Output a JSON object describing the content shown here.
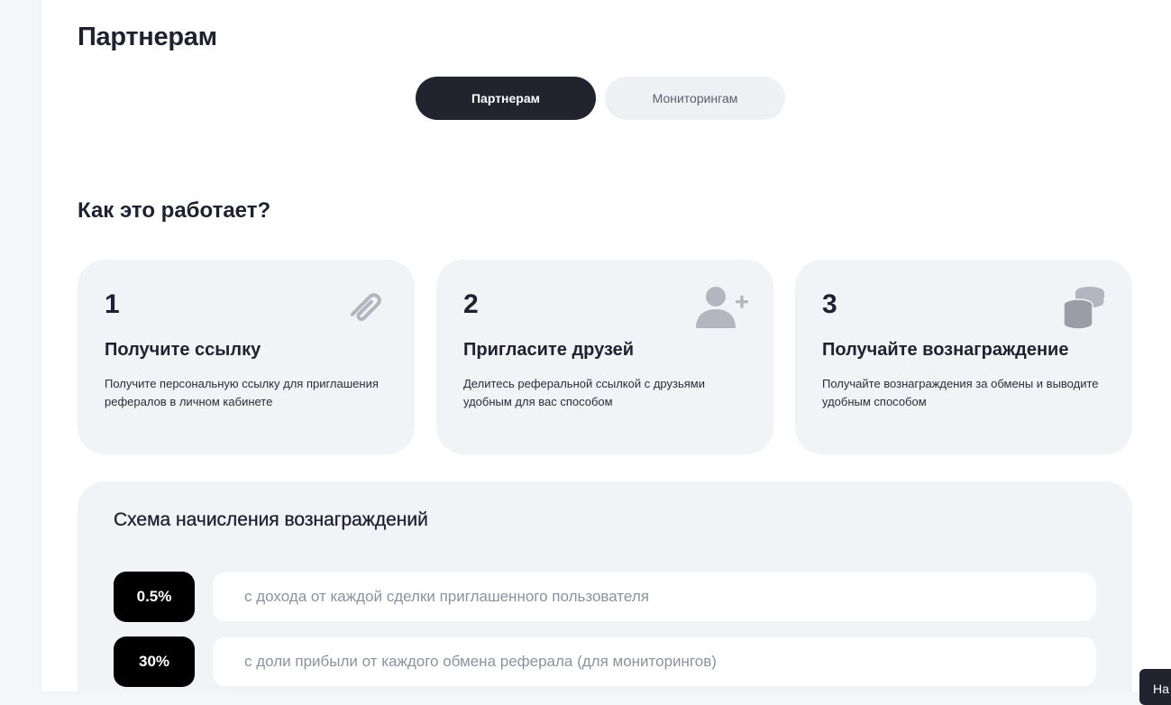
{
  "page": {
    "title": "Партнерам"
  },
  "tabs": [
    {
      "label": "Партнерам",
      "active": true
    },
    {
      "label": "Мониторингам",
      "active": false
    }
  ],
  "how_it_works": {
    "title": "Как это работает?",
    "steps": [
      {
        "number": "1",
        "title": "Получите ссылку",
        "description": "Получите персональную ссылку для приглашения рефералов в личном кабинете",
        "icon": "paperclip-icon"
      },
      {
        "number": "2",
        "title": "Пригласите друзей",
        "description": "Делитесь реферальной ссылкой с друзьями удобным для вас способом",
        "icon": "add-user-icon"
      },
      {
        "number": "3",
        "title": "Получайте вознаграждение",
        "description": "Получайте вознаграждения за обмены и выводите удобным способом",
        "icon": "coins-icon"
      }
    ]
  },
  "reward_scheme": {
    "title": "Схема начисления вознаграждений",
    "rates": [
      {
        "value": "0.5%",
        "description": "с дохода от каждой сделки приглашенного пользователя"
      },
      {
        "value": "30%",
        "description": "с доли прибыли от каждого обмена реферала (для мониторингов)"
      }
    ]
  },
  "corner_button": {
    "label": "На"
  },
  "colors": {
    "dark": "#22232f",
    "card_bg": "#f2f3f7",
    "icon_gray": "#b4b6bf",
    "muted_text": "#8d90a0"
  }
}
